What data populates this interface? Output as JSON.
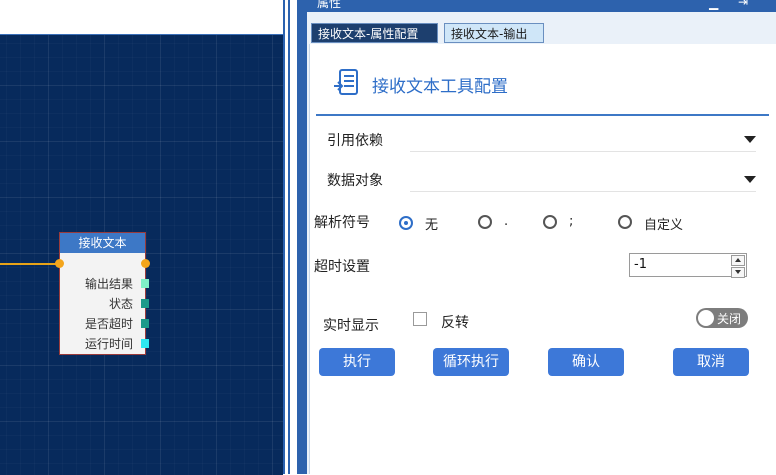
{
  "panel": {
    "title": "属性",
    "tabs": [
      {
        "label": "接收文本-属性配置",
        "active": true
      },
      {
        "label": "接收文本-输出",
        "active": false
      }
    ]
  },
  "config": {
    "title": "接收文本工具配置",
    "fields": {
      "dependency_label": "引用依赖",
      "dependency_value": "",
      "data_object_label": "数据对象",
      "data_object_value": ""
    },
    "parse": {
      "label": "解析符号",
      "options": [
        "无",
        ".",
        ";",
        "自定义"
      ],
      "selected": "无"
    },
    "timeout": {
      "label": "超时设置",
      "value": "-1"
    },
    "realtime": {
      "label": "实时显示",
      "invert_label": "反转",
      "invert_checked": false,
      "toggle_label": "关闭",
      "toggle_on": false
    },
    "buttons": {
      "run": "执行",
      "loop_run": "循环执行",
      "confirm": "确认",
      "cancel": "取消"
    }
  },
  "node": {
    "title": "接收文本",
    "outputs": [
      "输出结果",
      "状态",
      "是否超时",
      "运行时间"
    ],
    "port_colors": [
      "#7ff0c8",
      "#1c9a8a",
      "#1c9a8a",
      "#2ee7f0"
    ]
  },
  "colors": {
    "accent": "#3d78d8",
    "canvas": "#072a5c",
    "header": "#2d62ad",
    "connector": "#e8a317"
  }
}
